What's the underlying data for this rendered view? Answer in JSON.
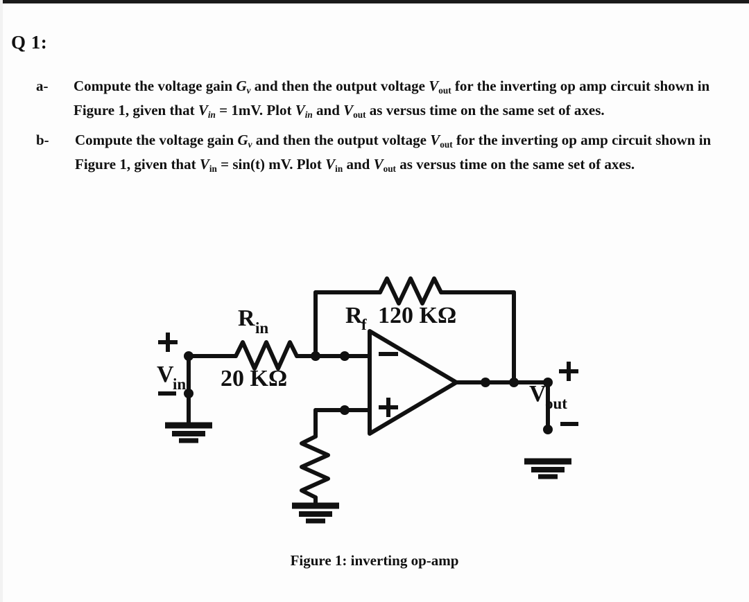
{
  "document": {
    "heading": "Q 1:",
    "figure_caption": "Figure 1: inverting op-amp"
  },
  "questions": [
    {
      "marker": "a-",
      "line1_pre": "Compute the voltage gain ",
      "gain_symbol": "G",
      "gain_sub": "v",
      "line1_mid": " and then the output voltage ",
      "vout_symbol": "V",
      "vout_sub": "out",
      "line1_post": " for the inverting op amp",
      "line2_pre": "circuit shown in Figure 1, given that ",
      "vin_symbol": "V",
      "vin_sub": "in",
      "equals": " = ",
      "value": "1mV",
      "line2_mid": ". Plot ",
      "and_text": " and ",
      "line2_post": " as versus time on the",
      "line3": "same set of axes."
    },
    {
      "marker": "b-",
      "line1_pre": "Compute the voltage gain ",
      "gain_symbol": "G",
      "gain_sub": "v",
      "line1_mid": " and then the output voltage ",
      "vout_symbol": "V",
      "vout_sub": "out",
      "line1_post": " for the inverting op amp",
      "line2_pre": "circuit shown in Figure 1, given that ",
      "vin_symbol": "V",
      "vin_sub": "in",
      "equals": " = ",
      "value": "sin(t) mV",
      "line2_mid": ". Plot ",
      "and_text": " and ",
      "line2_post": " as versus time on",
      "line3": "the same set of axes."
    }
  ],
  "circuit": {
    "type": "inverting-op-amp",
    "labels": {
      "rin_name": "R",
      "rin_sub": "in",
      "rin_value": "20 KΩ",
      "rf_name": "R",
      "rf_sub": "f",
      "rf_value": "120 KΩ",
      "vin_name": "V",
      "vin_sub": "in",
      "vout_name": "V",
      "vout_sub": "out",
      "plus_input_source": "+",
      "minus_input_source": "−",
      "plus_output": "+",
      "minus_output": "−",
      "opamp_inverting": "−",
      "opamp_noninverting": "+"
    },
    "colors": {
      "ink": "#111111",
      "paper": "#fdfdfd"
    }
  }
}
